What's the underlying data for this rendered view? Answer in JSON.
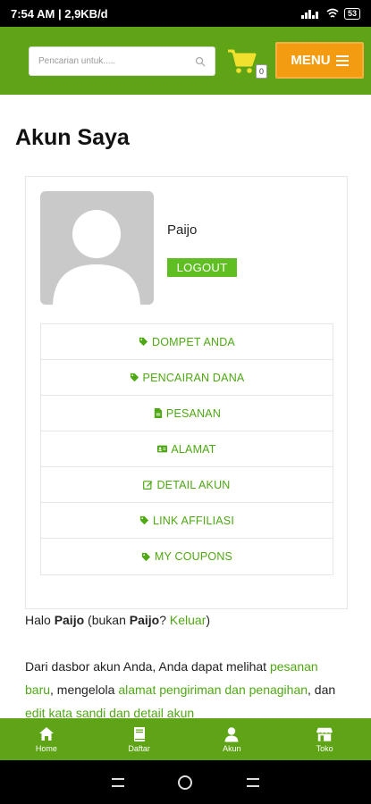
{
  "status_bar": {
    "time": "7:54 AM | 2,9KB/d",
    "battery": "53"
  },
  "header": {
    "search_placeholder": "Pencarian untuk.....",
    "cart_count": "0",
    "menu_label": "MENU"
  },
  "page": {
    "title": "Akun Saya"
  },
  "account": {
    "username": "Paijo",
    "logout_label": "LOGOUT",
    "nav_items": [
      {
        "label": "DOMPET ANDA",
        "icon": "tag-icon"
      },
      {
        "label": "PENCAIRAN DANA",
        "icon": "tag-icon"
      },
      {
        "label": "PESANAN",
        "icon": "file-icon"
      },
      {
        "label": "ALAMAT",
        "icon": "address-card-icon"
      },
      {
        "label": "DETAIL AKUN",
        "icon": "edit-icon"
      },
      {
        "label": "LINK AFFILIASI",
        "icon": "tag-icon"
      },
      {
        "label": "MY COUPONS",
        "icon": "tag-icon"
      }
    ]
  },
  "greeting": {
    "prefix": "Halo",
    "name": "Paijo",
    "middle": "(bukan",
    "name2": "Paijo",
    "question": "?",
    "logout_link": "Keluar",
    "suffix": ")"
  },
  "description": {
    "part1": "Dari dasbor akun Anda, Anda dapat melihat",
    "link1": "pesanan baru",
    "part2": ", mengelola",
    "link2": "alamat pengiriman dan penagihan",
    "part3": ", dan",
    "link3": "edit kata sandi dan detail akun"
  },
  "bottom_nav": [
    {
      "label": "Home",
      "icon": "home-icon"
    },
    {
      "label": "Daftar",
      "icon": "book-icon"
    },
    {
      "label": "Akun",
      "icon": "user-icon"
    },
    {
      "label": "Toko",
      "icon": "store-icon"
    }
  ],
  "colors": {
    "brand_green": "#5fa416",
    "link_green": "#4ea812",
    "menu_orange": "#f39c12",
    "cart_yellow": "#f1e12e"
  }
}
